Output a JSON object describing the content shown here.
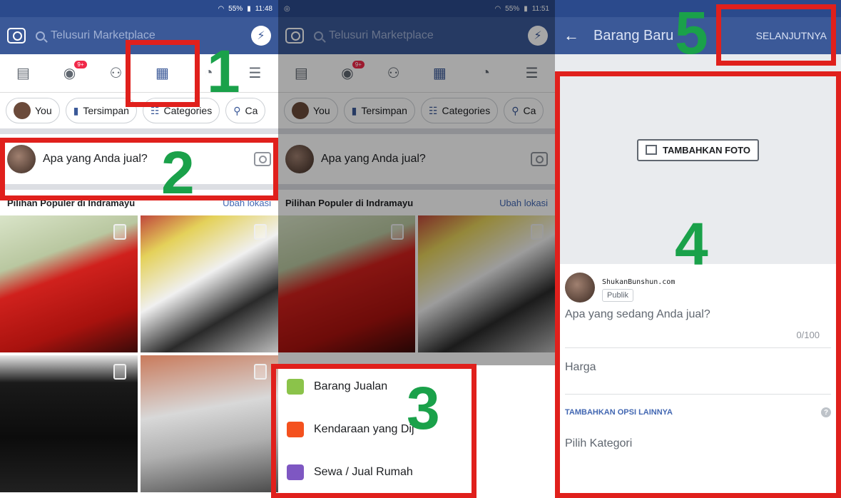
{
  "panel1": {
    "status": {
      "signal": "55%",
      "time": "11:48"
    },
    "search_placeholder": "Telusuri Marketplace",
    "nav_badge": "9+",
    "chips": [
      "You",
      "Tersimpan",
      "Categories",
      "Ca"
    ],
    "composer_prompt": "Apa yang Anda jual?",
    "popular_title": "Pilihan Populer di Indramayu",
    "change_location": "Ubah lokasi"
  },
  "panel2": {
    "status": {
      "signal": "55%",
      "time": "11:51"
    },
    "search_placeholder": "Telusuri Marketplace",
    "nav_badge": "9+",
    "chips": [
      "You",
      "Tersimpan",
      "Categories",
      "Ca"
    ],
    "composer_prompt": "Apa yang Anda jual?",
    "popular_title": "Pilihan Populer di Indramayu",
    "change_location": "Ubah lokasi",
    "menu": [
      {
        "label": "Barang Jualan",
        "icon": "shopping-bag-icon",
        "color": "#8bc34a"
      },
      {
        "label": "Kendaraan yang Dij",
        "icon": "car-icon",
        "color": "#f4511e"
      },
      {
        "label": "Sewa / Jual Rumah",
        "icon": "house-icon",
        "color": "#7e57c2"
      }
    ]
  },
  "panel3": {
    "title": "Barang Baru",
    "next_button": "SELANJUTNYA",
    "add_photo": "TAMBAHKAN FOTO",
    "watermark": "ShukanBunshun.com",
    "audience": "Publik",
    "question": "Apa yang sedang Anda jual?",
    "char_count": "0/100",
    "price_label": "Harga",
    "more_options": "TAMBAHKAN OPSI LAINNYA",
    "category_label": "Pilih Kategori"
  },
  "annotations": {
    "step1": "1",
    "step2": "2",
    "step3": "3",
    "step4": "4",
    "step5": "5",
    "box_color": "#e0201c",
    "number_color": "#1aa14a"
  },
  "colors": {
    "facebook_blue": "#3b5998",
    "link_blue": "#4267b2"
  }
}
